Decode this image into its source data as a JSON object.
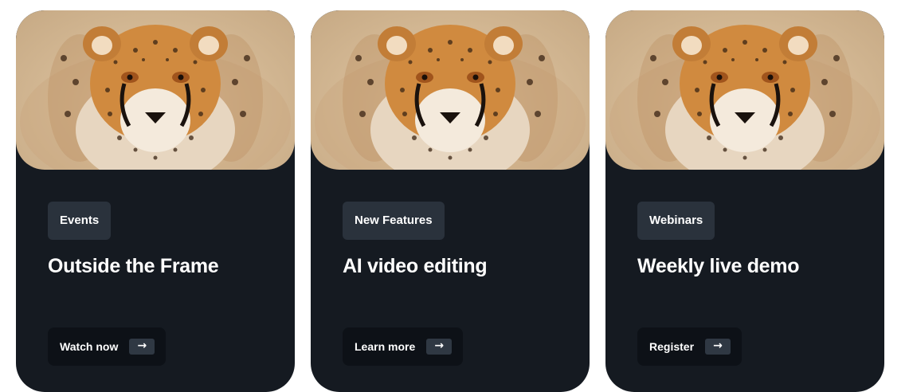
{
  "cards": [
    {
      "tag": "Events",
      "title": "Outside the Frame",
      "cta": "Watch now",
      "arrow": "→",
      "image": "cheetah-portrait"
    },
    {
      "tag": "New Features",
      "title": "AI video editing",
      "cta": "Learn more",
      "arrow": "→",
      "image": "cheetah-portrait"
    },
    {
      "tag": "Webinars",
      "title": "Weekly live demo",
      "cta": "Register",
      "arrow": "→",
      "image": "cheetah-portrait"
    }
  ],
  "colors": {
    "card_bg": "#151a21",
    "tag_bg": "#2a323c",
    "button_bg": "#0d1117",
    "arrow_bg": "#2f3843"
  }
}
